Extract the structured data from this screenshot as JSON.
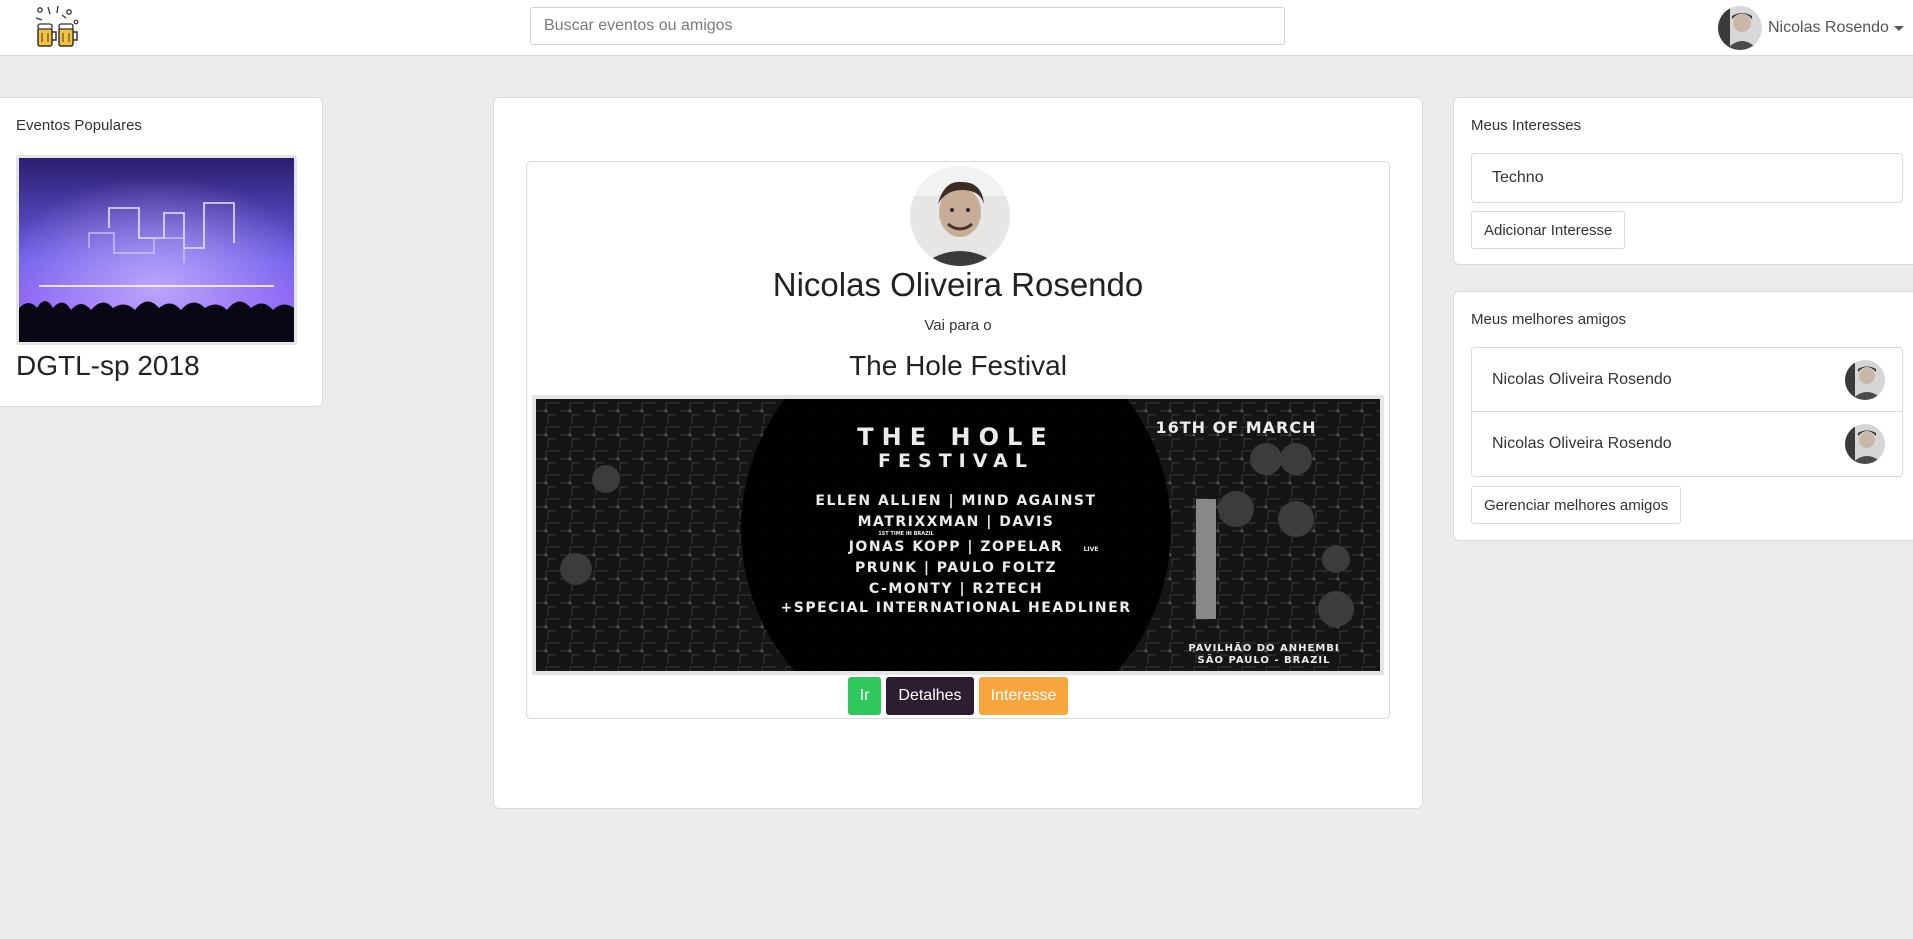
{
  "header": {
    "logo_icon": "beer-celebration-logo-icon",
    "search_placeholder": "Buscar eventos ou amigos",
    "user_name": "Nicolas Rosendo"
  },
  "popular": {
    "title": "Eventos Populares",
    "event_name": "DGTL-sp 2018"
  },
  "feed": {
    "person_name": "Nicolas Oliveira Rosendo",
    "goes_to": "Vai para o",
    "event_name": "The Hole Festival",
    "poster": {
      "title_line1": "THE HOLE",
      "title_line2": "FESTIVAL",
      "date": "16TH OF MARCH",
      "lineup": [
        "ELLEN ALLIEN | MIND AGAINST",
        "MATRIXXMAN | DAVIS",
        "JONAS KOPP | ZOPELAR",
        "PRUNK | PAULO FOLTZ",
        "C-MONTY | R2TECH",
        "+SPECIAL INTERNATIONAL HEADLINER"
      ],
      "note": "1ST TIME IN BRAZIL",
      "live_tag": "LIVE",
      "venue": "PAVILHÃO DO ANHEMBI",
      "city": "SÃO PAULO - BRAZIL"
    },
    "buttons": {
      "go": "Ir",
      "details": "Detalhes",
      "interest": "Interesse"
    },
    "colors": {
      "go": "#2fc85c",
      "details": "#2c1d30",
      "interest": "#f7a63e"
    }
  },
  "interests": {
    "title": "Meus Interesses",
    "items": [
      "Techno"
    ],
    "add_button": "Adicionar Interesse"
  },
  "best_friends": {
    "title": "Meus melhores amigos",
    "friends": [
      {
        "name": "Nicolas Oliveira Rosendo"
      },
      {
        "name": "Nicolas Oliveira Rosendo"
      }
    ],
    "manage_button": "Gerenciar melhores amigos"
  }
}
